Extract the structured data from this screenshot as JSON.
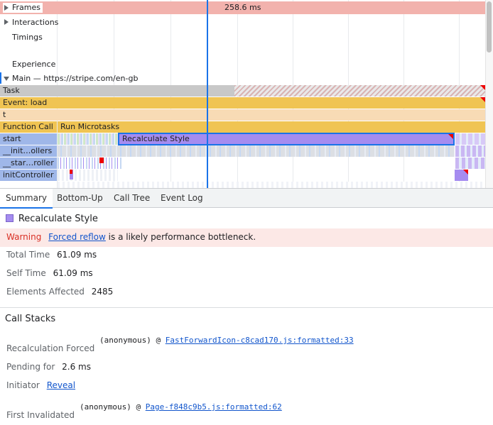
{
  "timeline": {
    "frames_label": "Frames",
    "frames_duration": "258.6 ms",
    "interactions_label": "Interactions",
    "timings_label": "Timings",
    "experience_label": "Experience",
    "main_label": "Main — https://stripe.com/en-gb",
    "flame": {
      "task": "Task",
      "event_load": "Event: load",
      "t": "t",
      "function_call": "Function Call",
      "run_microtasks": "Run Microtasks",
      "start": "start",
      "recalculate_style": "Recalculate Style",
      "init_ollers": "__init…ollers",
      "star_roller": "__star…roller",
      "init_controller": "initController"
    },
    "colors": {
      "frames": "#f2b2ad",
      "task": "#c8c8c8",
      "event": "#f0c453",
      "t_row": "#f8dbb5",
      "start_blue": "#9fb7e9",
      "recalc_purple": "#a58cf0",
      "cursor": "#1a73e8"
    }
  },
  "tabs": [
    "Summary",
    "Bottom-Up",
    "Call Tree",
    "Event Log"
  ],
  "summary": {
    "title": "Recalculate Style",
    "swatch_color": "#a58cf0",
    "warning_label": "Warning",
    "warning_link": "Forced reflow",
    "warning_text": "is a likely performance bottleneck.",
    "total_time_label": "Total Time",
    "total_time_value": "61.09 ms",
    "self_time_label": "Self Time",
    "self_time_value": "61.09 ms",
    "elements_label": "Elements Affected",
    "elements_value": "2485",
    "call_stacks_heading": "Call Stacks",
    "recalc_forced_label": "Recalculation Forced",
    "recalc_forced_fn": "(anonymous) @",
    "recalc_forced_link": "FastForwardIcon-c8cad170.js:formatted:33",
    "pending_label": "Pending for",
    "pending_value": "2.6 ms",
    "initiator_label": "Initiator",
    "initiator_link": "Reveal",
    "first_invalidated_label": "First Invalidated",
    "first_invalidated_fn": "(anonymous) @",
    "first_invalidated_link": "Page-f848c9b5.js:formatted:62"
  }
}
